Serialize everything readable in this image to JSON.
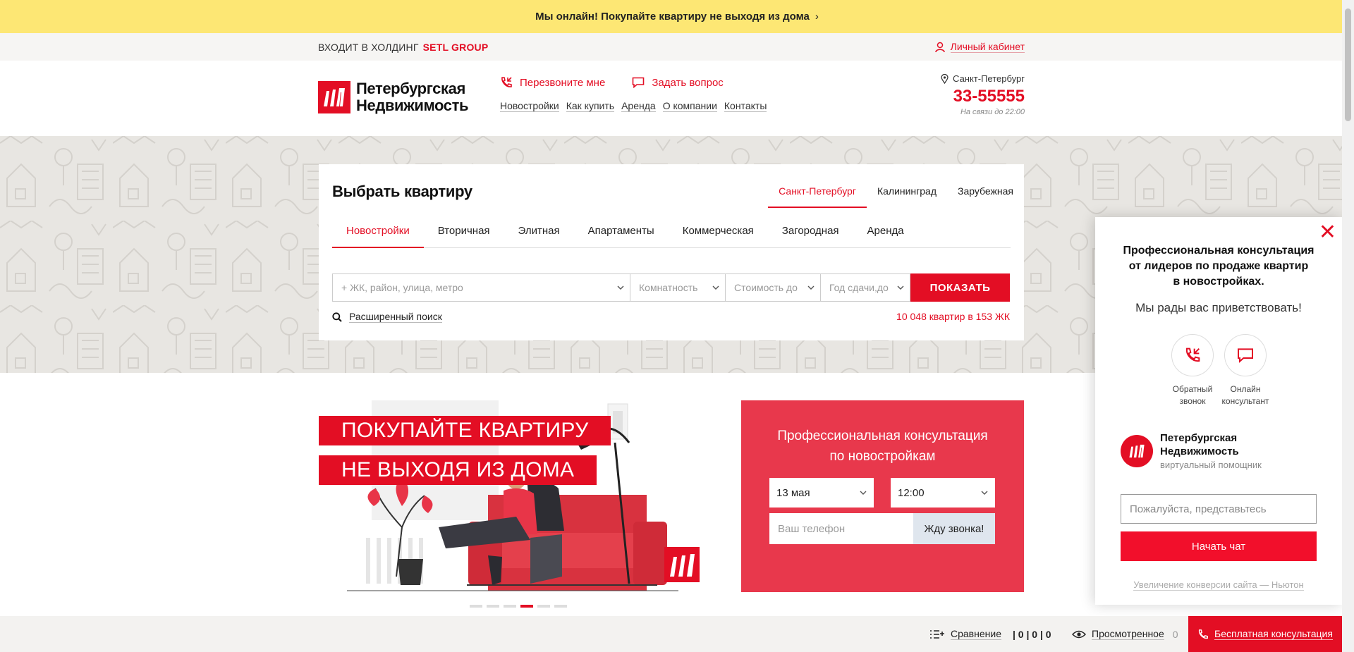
{
  "promo_bar": {
    "text": "Мы онлайн! Покупайте квартиру не выходя из дома",
    "chevron": "›"
  },
  "holding": {
    "prefix": "ВХОДИТ В ХОЛДИНГ",
    "brand": "SETL GROUP",
    "account_link": "Личный кабинет"
  },
  "header": {
    "logo_line1": "Петербургская",
    "logo_line2": "Недвижимость",
    "callback": "Перезвоните мне",
    "ask_question": "Задать вопрос",
    "nav": [
      "Новостройки",
      "Как купить",
      "Аренда",
      "О компании",
      "Контакты"
    ],
    "city": "Санкт-Петербург",
    "phone": "33-55555",
    "hours": "На связи до 22:00"
  },
  "search": {
    "title": "Выбрать квартиру",
    "regions": [
      "Санкт-Петербург",
      "Калининград",
      "Зарубежная"
    ],
    "active_region": 0,
    "types": [
      "Новостройки",
      "Вторичная",
      "Элитная",
      "Апартаменты",
      "Коммерческая",
      "Загородная",
      "Аренда"
    ],
    "active_type": 0,
    "query_placeholder": "+ ЖК, район, улица, метро",
    "rooms_placeholder": "Комнатность",
    "price_placeholder": "Стоимость до",
    "year_placeholder": "Год сдачи,до",
    "submit": "ПОКАЗАТЬ",
    "advanced": "Расширенный поиск",
    "count": "10 048 квартир в 153 ЖК"
  },
  "banner": {
    "line1": "ПОКУПАЙТЕ КВАРТИРУ",
    "line2": "НЕ ВЫХОДЯ ИЗ ДОМА",
    "slides": 6,
    "active_slide": 3
  },
  "consult_form": {
    "title_line1": "Профессиональная консультация",
    "title_line2": "по новостройкам",
    "date": "13 мая",
    "time": "12:00",
    "phone_placeholder": "Ваш телефон",
    "submit": "Жду звонка!"
  },
  "chat": {
    "close": "✕",
    "title_line1": "Профессиональная консультация",
    "title_line2": "от лидеров по продаже квартир",
    "title_line3": "в новостройках.",
    "greeting": "Мы рады вас приветствовать!",
    "option1_line1": "Обратный",
    "option1_line2": "звонок",
    "option2_line1": "Онлайн",
    "option2_line2": "консультант",
    "brand_line1": "Петербургская",
    "brand_line2": "Недвижимость",
    "brand_sub": "виртуальный помощник",
    "name_placeholder": "Пожалуйста, представьтесь",
    "start": "Начать чат",
    "footer": "Увеличение конверсии сайта — Ньютон"
  },
  "bottom_bar": {
    "compare": "Сравнение",
    "compare_counts": "| 0 | 0 | 0",
    "viewed": "Просмотренное",
    "viewed_count": "0",
    "consult": "Бесплатная консультация"
  },
  "colors": {
    "brand_red": "#e30e24",
    "promo_yellow": "#fde774",
    "consult_red": "#e8384c"
  }
}
